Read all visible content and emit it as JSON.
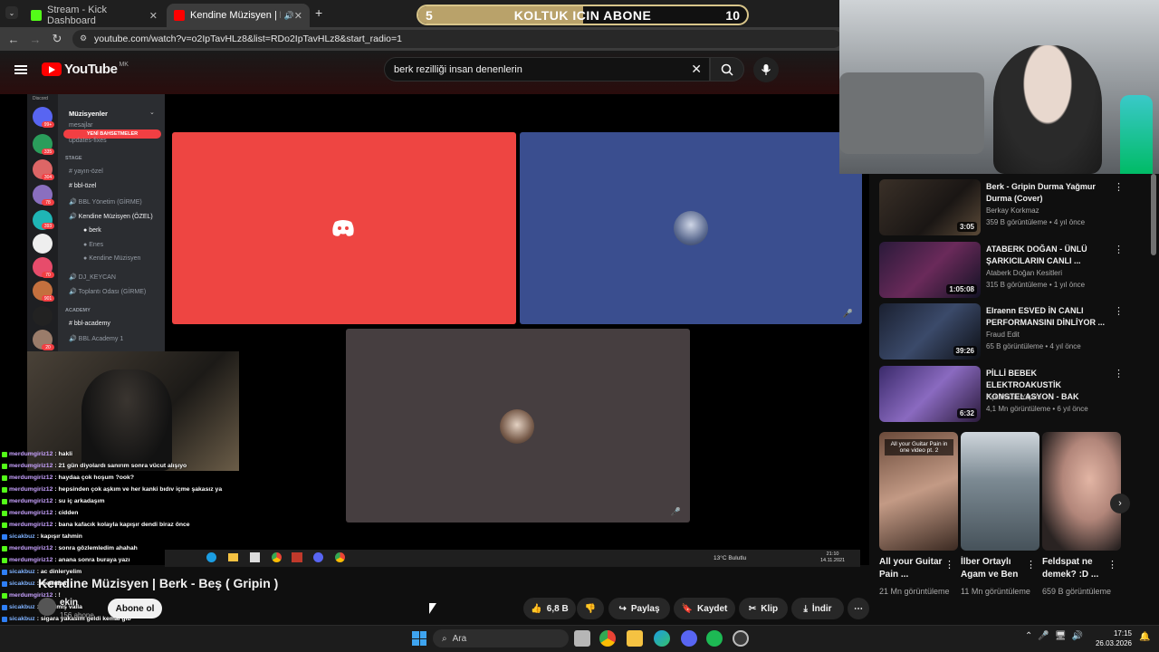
{
  "browser": {
    "tabs": [
      {
        "label": "Stream - Kick Dashboard",
        "color": "#53fc18"
      },
      {
        "label": "Kendine Müzisyen | Berk - E",
        "color": "#ff0000"
      }
    ],
    "new_tab": "+",
    "url": "youtube.com/watch?v=o2IpTavHLz8&list=RDo2IpTavHLz8&start_radio=1"
  },
  "sub_goal": {
    "current": "5",
    "label": "KOLTUK ICIN ABONE",
    "target": "10",
    "progress": 0.5
  },
  "youtube": {
    "logo": "YouTube",
    "country": "MK",
    "search_value": "berk rezilliği insan denenlerin",
    "video": {
      "title": "Kendine Müzisyen | Berk - Beş ( Gripin )",
      "channel": "ekin",
      "subscribers": "156 abone",
      "subscribe_label": "Abone ol",
      "likes": "6,8 B",
      "share": "Paylaş",
      "save": "Kaydet",
      "clip": "Klip",
      "download": "İndir"
    },
    "recommendations": [
      {
        "title": "Berk - Gripin Durma Yağmur Durma (Cover)",
        "channel": "Berkay Korkmaz",
        "meta": "359 B görüntüleme • 4 yıl önce",
        "duration": "3:05"
      },
      {
        "title": "ATABERK DOĞAN - ÜNLÜ ŞARKICILARIN CANLI ...",
        "channel": "Ataberk Doğan Kesitleri",
        "meta": "315 B görüntüleme • 1 yıl önce",
        "duration": "1:05:08"
      },
      {
        "title": "Elraenn ESVED İN CANLI PERFORMANSINI DİNLİYOR ...",
        "channel": "Fraud Edit",
        "meta": "65 B görüntüleme • 4 yıl önce",
        "duration": "39:26"
      },
      {
        "title": "PİLLİ BEBEK ELEKTROAKUSTİK KONSTELASYON - BAK",
        "channel": "Aşk Müzik Yapım",
        "meta": "4,1 Mn görüntüleme • 6 yıl önce",
        "duration": "6:32"
      }
    ],
    "shorts": [
      {
        "title": "All your Guitar Pain ...",
        "views": "21 Mn görüntüleme",
        "caption": "All your Guitar Pain in one video pt. 2"
      },
      {
        "title": "İlber Ortaylı Agam ve Ben",
        "views": "11 Mn görüntüleme"
      },
      {
        "title": "Feldspat ne demek? :D ...",
        "views": "659 B görüntüleme"
      }
    ]
  },
  "discord": {
    "server_label": "Discord",
    "header": "Müzisyenler",
    "mentions": "YENİ BAHSETMELER",
    "channels_top": [
      "mesajlar",
      "updates-fixes"
    ],
    "stage_category": "STAGE",
    "stage_channels": [
      "yayın-özel",
      "bbl-özel",
      "BBL Yönetim (GİRME)",
      "Kendine Müzisyen (ÖZEL)"
    ],
    "voice_users": [
      "berk",
      "Enes",
      "Kendine Müzisyen"
    ],
    "more_channels": [
      "DJ_KEYCAN",
      "Toplantı Odası (GİRME)"
    ],
    "academy_category": "ACADEMY",
    "academy_channels": [
      "bbl-academy",
      "BBL Academy 1"
    ],
    "server_badges": [
      "99+",
      "335",
      "304",
      "78",
      "393",
      "70",
      "901",
      "20"
    ]
  },
  "inner_taskbar": {
    "weather": "13°C Bulutlu",
    "time": "21:10",
    "date": "14.11.2021"
  },
  "chat": [
    {
      "user": "merdumgiriz12",
      "msg": ": hakli"
    },
    {
      "user": "merdumgiriz12",
      "msg": ": 21 gün diyolardı sanırım sonra vücut alışıyo"
    },
    {
      "user": "merdumgiriz12",
      "msg": ": haydaa çok hoşum ?ook?"
    },
    {
      "user": "merdumgiriz12",
      "msg": ": hepsinden çok aşkım ve her kanki bıdıv içme şakasız ya"
    },
    {
      "user": "merdumgiriz12",
      "msg": ": su iç arkadaşım"
    },
    {
      "user": "merdumgiriz12",
      "msg": ": cidden"
    },
    {
      "user": "merdumgiriz12",
      "msg": ": bana kafacık kolayla kapışır dendi biraz önce"
    },
    {
      "user": "sicakbuz",
      "msg": ": kapışır tahmin"
    },
    {
      "user": "merdumgiriz12",
      "msg": ": sonra gözlemledim ahahah"
    },
    {
      "user": "merdumgiriz12",
      "msg": ": anana sonra buraya yazı"
    },
    {
      "user": "sicakbuz",
      "msg": ": ac dinleryelim"
    },
    {
      "user": "sicakbuz",
      "msg": ": merhaba"
    },
    {
      "user": "merdumgiriz12",
      "msg": ": !"
    },
    {
      "user": "sicakbuz",
      "msg": ": güzelmiş valla"
    },
    {
      "user": "sicakbuz",
      "msg": ": sigara yakasım geldi kemal gib"
    },
    {
      "user": "merdumgiriz",
      "msg": ": sarısı"
    },
    {
      "user": "sicakbuz",
      "msg": ":"
    }
  ],
  "taskbar": {
    "search_placeholder": "Ara",
    "time": "17:15",
    "date": "26.03.2026"
  }
}
